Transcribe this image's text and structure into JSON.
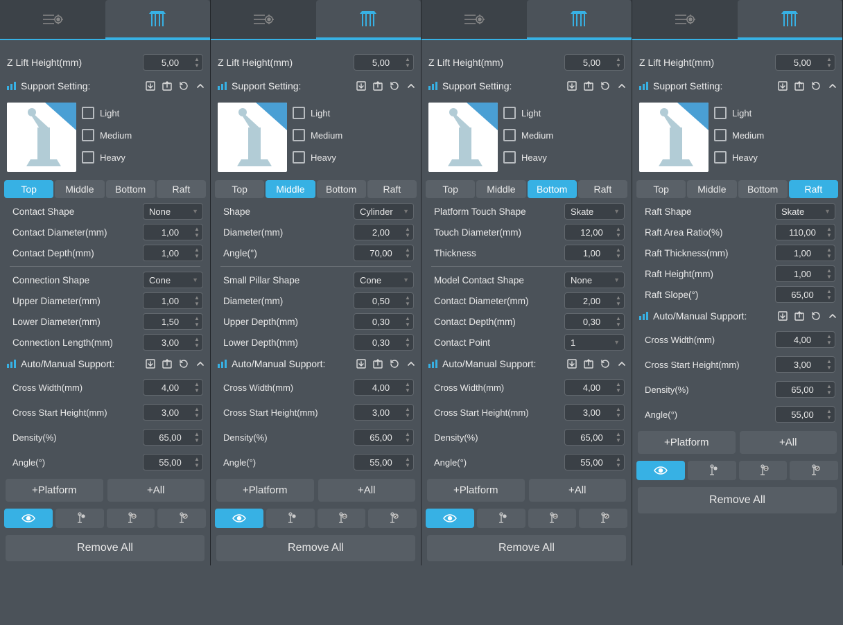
{
  "zlift_label": "Z Lift Height(mm)",
  "zlift_value": "5,00",
  "support_setting_label": "Support Setting:",
  "profiles": {
    "light": "Light",
    "medium": "Medium",
    "heavy": "Heavy"
  },
  "tabs": {
    "top": "Top",
    "middle": "Middle",
    "bottom": "Bottom",
    "raft": "Raft"
  },
  "auto_manual_label": "Auto/Manual Support:",
  "auto_manual": {
    "cross_width": {
      "label": "Cross Width(mm)",
      "value": "4,00"
    },
    "cross_start": {
      "label": "Cross Start Height(mm)",
      "value": "3,00"
    },
    "density": {
      "label": "Density(%)",
      "value": "65,00"
    },
    "angle": {
      "label": "Angle(°)",
      "value": "55,00"
    }
  },
  "platform_btn": "+Platform",
  "all_btn": "+All",
  "remove_all": "Remove All",
  "panels": {
    "top": {
      "fields1": [
        {
          "label": "Contact Shape",
          "type": "sel",
          "value": "None"
        },
        {
          "label": "Contact Diameter(mm)",
          "type": "spin",
          "value": "1,00"
        },
        {
          "label": "Contact Depth(mm)",
          "type": "spin",
          "value": "1,00"
        }
      ],
      "fields2": [
        {
          "label": "Connection Shape",
          "type": "sel",
          "value": "Cone"
        },
        {
          "label": "Upper Diameter(mm)",
          "type": "spin",
          "value": "1,00"
        },
        {
          "label": "Lower Diameter(mm)",
          "type": "spin",
          "value": "1,50"
        },
        {
          "label": "Connection Length(mm)",
          "type": "spin",
          "value": "3,00"
        }
      ]
    },
    "middle": {
      "fields1": [
        {
          "label": "Shape",
          "type": "sel",
          "value": "Cylinder"
        },
        {
          "label": "Diameter(mm)",
          "type": "spin",
          "value": "2,00"
        },
        {
          "label": "Angle(°)",
          "type": "spin",
          "value": "70,00"
        }
      ],
      "fields2": [
        {
          "label": "Small Pillar Shape",
          "type": "sel",
          "value": "Cone"
        },
        {
          "label": "Diameter(mm)",
          "type": "spin",
          "value": "0,50"
        },
        {
          "label": "Upper Depth(mm)",
          "type": "spin",
          "value": "0,30"
        },
        {
          "label": "Lower Depth(mm)",
          "type": "spin",
          "value": "0,30"
        }
      ]
    },
    "bottom": {
      "fields1": [
        {
          "label": "Platform Touch Shape",
          "type": "sel",
          "value": "Skate"
        },
        {
          "label": "Touch Diameter(mm)",
          "type": "spin",
          "value": "12,00"
        },
        {
          "label": "Thickness",
          "type": "spin",
          "value": "1,00"
        }
      ],
      "fields2": [
        {
          "label": "Model Contact Shape",
          "type": "sel",
          "value": "None"
        },
        {
          "label": "Contact Diameter(mm)",
          "type": "spin",
          "value": "2,00"
        },
        {
          "label": "Contact Depth(mm)",
          "type": "spin",
          "value": "0,30"
        },
        {
          "label": "Contact Point",
          "type": "sel",
          "value": "1"
        }
      ]
    },
    "raft": {
      "fields1": [
        {
          "label": "Raft Shape",
          "type": "sel",
          "value": "Skate"
        },
        {
          "label": "Raft Area Ratio(%)",
          "type": "spin",
          "value": "110,00"
        },
        {
          "label": "Raft Thickness(mm)",
          "type": "spin",
          "value": "1,00"
        },
        {
          "label": "Raft Height(mm)",
          "type": "spin",
          "value": "1,00"
        },
        {
          "label": "Raft Slope(°)",
          "type": "spin",
          "value": "65,00"
        }
      ]
    }
  }
}
